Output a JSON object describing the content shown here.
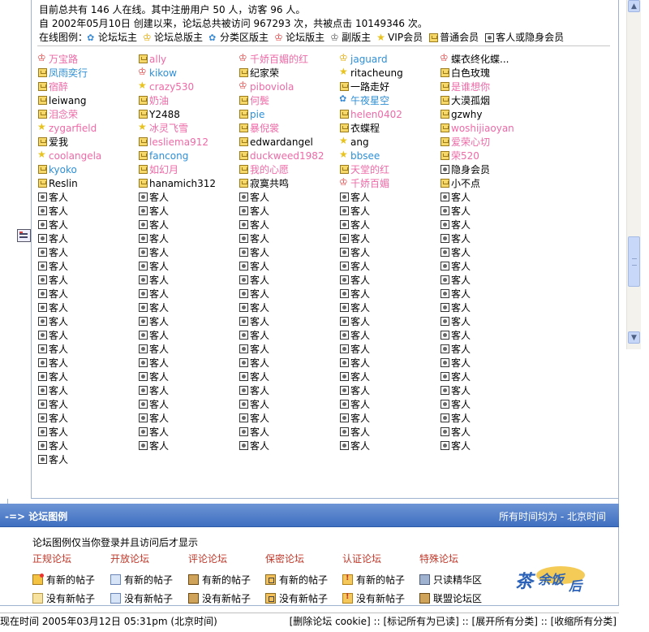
{
  "stats": {
    "line1": "目前总共有 146 人在线。其中注册用户 50 人，访客 96 人。",
    "line2": "自 2002年05月10日 创建以来，论坛总共被访问 967293 次，共被点击 10149346 次。",
    "legend_label": "在线图例：",
    "legend_items": [
      "论坛坛主",
      "论坛总版主",
      "分类区版主",
      "论坛版主",
      "副版主",
      "VIP会员",
      "普通会员",
      "客人或隐身会员"
    ]
  },
  "online_users": [
    {
      "name": "万宝路",
      "type": "admin",
      "color": "pink"
    },
    {
      "name": "ally",
      "type": "member",
      "color": "pink"
    },
    {
      "name": "千娇百媚的红",
      "type": "admin",
      "color": "pink"
    },
    {
      "name": "jaguard",
      "type": "master",
      "color": "blue"
    },
    {
      "name": "蝶衣终化蝶...",
      "type": "admin",
      "color": "black"
    },
    {
      "name": "凤雨奕行",
      "type": "member",
      "color": "blue"
    },
    {
      "name": "kikow",
      "type": "admin",
      "color": "blue"
    },
    {
      "name": "纪家荣",
      "type": "member",
      "color": "black"
    },
    {
      "name": "ritacheung",
      "type": "vip",
      "color": "black"
    },
    {
      "name": "白色玫瑰",
      "type": "member",
      "color": "black"
    },
    {
      "name": "宿醉",
      "type": "member",
      "color": "pink"
    },
    {
      "name": "crazy530",
      "type": "vip",
      "color": "pink"
    },
    {
      "name": "piboviola",
      "type": "admin",
      "color": "pink"
    },
    {
      "name": "一路走好",
      "type": "member",
      "color": "black"
    },
    {
      "name": "是谁想你",
      "type": "member",
      "color": "pink"
    },
    {
      "name": "leiwang",
      "type": "member",
      "color": "black"
    },
    {
      "name": "奶油",
      "type": "member",
      "color": "pink"
    },
    {
      "name": "何鬓",
      "type": "member",
      "color": "pink"
    },
    {
      "name": "午夜星空",
      "type": "section",
      "color": "blue"
    },
    {
      "name": "大漠孤烟",
      "type": "member",
      "color": "black"
    },
    {
      "name": "泪念荣",
      "type": "member",
      "color": "pink"
    },
    {
      "name": "Y2488",
      "type": "member",
      "color": "black"
    },
    {
      "name": "pie",
      "type": "member",
      "color": "blue"
    },
    {
      "name": "helen0402",
      "type": "member",
      "color": "pink"
    },
    {
      "name": "gzwhy",
      "type": "member",
      "color": "black"
    },
    {
      "name": "zygarfield",
      "type": "vip",
      "color": "pink"
    },
    {
      "name": "冰灵飞雪",
      "type": "vip",
      "color": "pink"
    },
    {
      "name": "暴倪裳",
      "type": "member",
      "color": "pink"
    },
    {
      "name": "衣蝶程",
      "type": "member",
      "color": "black"
    },
    {
      "name": "woshijiaoyan",
      "type": "member",
      "color": "pink"
    },
    {
      "name": "爱我",
      "type": "member",
      "color": "black"
    },
    {
      "name": "lesliema912",
      "type": "member",
      "color": "pink"
    },
    {
      "name": "edwardangel",
      "type": "member",
      "color": "black"
    },
    {
      "name": "ang",
      "type": "vip",
      "color": "black"
    },
    {
      "name": "爱荣心切",
      "type": "member",
      "color": "pink"
    },
    {
      "name": "coolangela",
      "type": "vip",
      "color": "pink"
    },
    {
      "name": "fancong",
      "type": "member",
      "color": "blue"
    },
    {
      "name": "duckweed1982",
      "type": "member",
      "color": "pink"
    },
    {
      "name": "bbsee",
      "type": "vip",
      "color": "blue"
    },
    {
      "name": "荣520",
      "type": "member",
      "color": "pink"
    },
    {
      "name": "kyoko",
      "type": "member",
      "color": "blue"
    },
    {
      "name": "如幻月",
      "type": "member",
      "color": "pink"
    },
    {
      "name": "我的心愿",
      "type": "member",
      "color": "pink"
    },
    {
      "name": "天堂的红",
      "type": "member",
      "color": "pink"
    },
    {
      "name": "隐身会员",
      "type": "guest",
      "color": "black"
    },
    {
      "name": "Reslin",
      "type": "member",
      "color": "black"
    },
    {
      "name": "hanamich312",
      "type": "member",
      "color": "black"
    },
    {
      "name": "寂寞共鸣",
      "type": "member",
      "color": "black"
    },
    {
      "name": "千娇百媚",
      "type": "admin",
      "color": "pink"
    },
    {
      "name": "小不点",
      "type": "member",
      "color": "black"
    }
  ],
  "guest_label": "客人",
  "guest_count": 96,
  "legend_bar": {
    "title": "-=> 论坛图例",
    "timezone": "所有时间均为 - 北京时间"
  },
  "legend_panel": {
    "note": "论坛图例仅当你登录并且访问后才显示",
    "categories": [
      {
        "title": "正规论坛",
        "new": "有新的帖子",
        "none": "没有新帖子"
      },
      {
        "title": "开放论坛",
        "new": "有新的帖子",
        "none": "没有新帖子"
      },
      {
        "title": "评论论坛",
        "new": "有新的帖子",
        "none": "没有新帖子"
      },
      {
        "title": "保密论坛",
        "new": "有新的帖子",
        "none": "没有新帖子"
      },
      {
        "title": "认证论坛",
        "new": "有新的帖子",
        "none": "没有新帖子"
      },
      {
        "title": "特殊论坛",
        "new": "只读精华区",
        "none": "联盟论坛区"
      }
    ]
  },
  "footer": {
    "time": "现在时间 2005年03月12日 05:31pm (北京时间)",
    "links": [
      "[删除论坛 cookie]",
      "[标记所有为已读]",
      "[展开所有分类]",
      "[收缩所有分类]"
    ],
    "sep": " :: "
  }
}
